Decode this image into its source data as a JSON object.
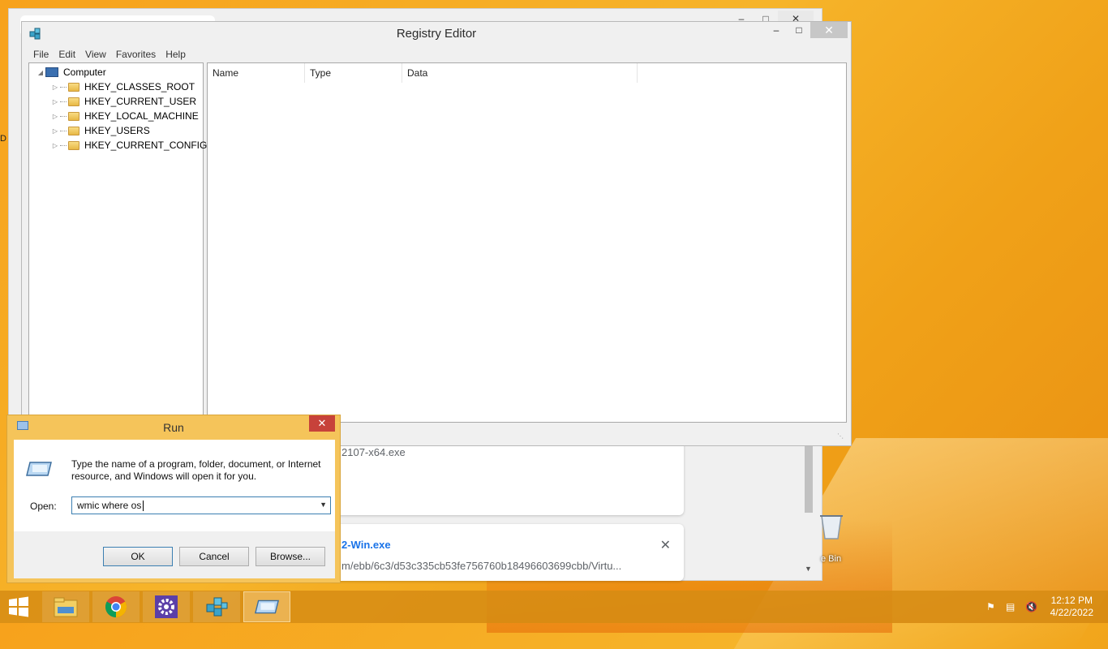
{
  "desktop": {
    "left_edge_text": "D",
    "recycle_bin_label": "e Bin"
  },
  "browser": {
    "downloads": [
      {
        "filename_fragment": "2107-x64.exe"
      },
      {
        "filename_fragment": "2-Win.exe",
        "url_fragment": "m/ebb/6c3/d53c335cb53fe756760b18496603699cbb/Virtu..."
      }
    ]
  },
  "registry_editor": {
    "title": "Registry Editor",
    "menu": [
      "File",
      "Edit",
      "View",
      "Favorites",
      "Help"
    ],
    "tree": {
      "root": "Computer",
      "children": [
        "HKEY_CLASSES_ROOT",
        "HKEY_CURRENT_USER",
        "HKEY_LOCAL_MACHINE",
        "HKEY_USERS",
        "HKEY_CURRENT_CONFIG"
      ]
    },
    "columns": [
      "Name",
      "Type",
      "Data"
    ]
  },
  "run_dialog": {
    "title": "Run",
    "description": "Type the name of a program, folder, document, or Internet resource, and Windows will open it for you.",
    "open_label": "Open:",
    "input_value": "wmic where os",
    "buttons": {
      "ok": "OK",
      "cancel": "Cancel",
      "browse": "Browse..."
    }
  },
  "taskbar": {
    "time": "12:12 PM",
    "date": "4/22/2022",
    "items": [
      "start-icon",
      "file-explorer-icon",
      "chrome-icon",
      "settings-icon",
      "registry-editor-icon",
      "run-icon"
    ]
  },
  "colors": {
    "accent": "#f5c45a",
    "close_red": "#c7423a",
    "desktop": "#f7a21c"
  }
}
